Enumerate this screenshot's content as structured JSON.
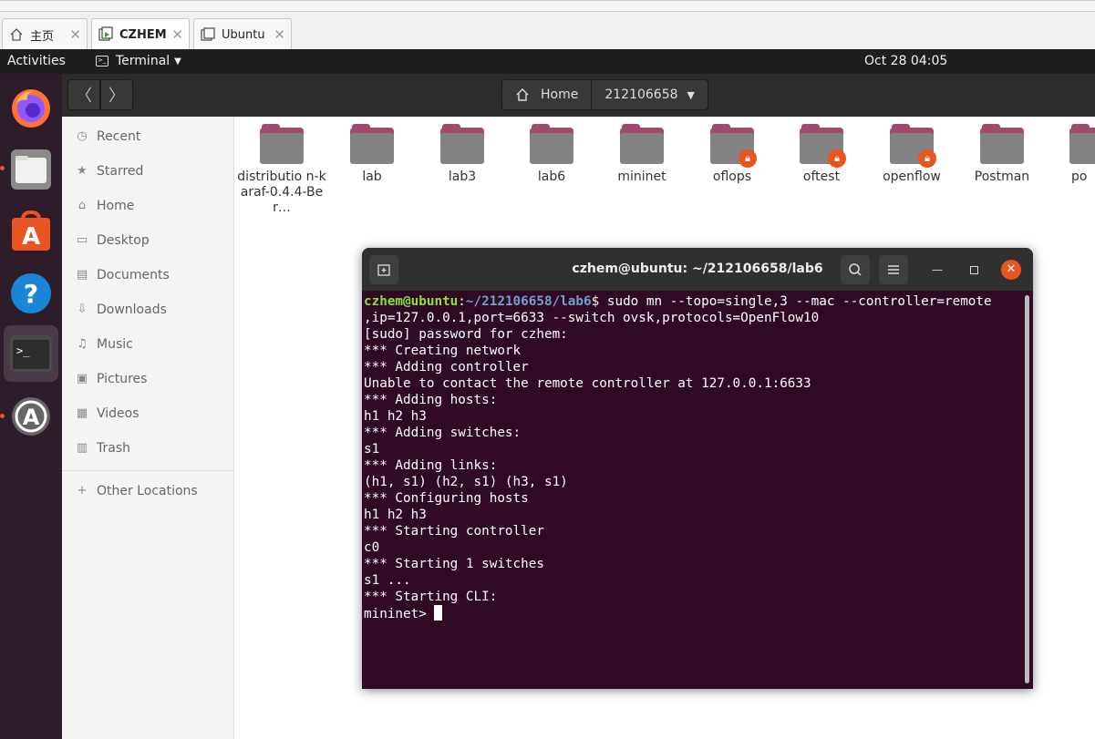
{
  "vm_tabs": [
    {
      "label": "主页",
      "icon": "home-icon"
    },
    {
      "label": "CZHEM",
      "icon": "vm-running-icon"
    },
    {
      "label": "Ubuntu",
      "icon": "vm-icon"
    }
  ],
  "topbar": {
    "activities": "Activities",
    "app_menu": "Terminal",
    "clock": "Oct 28  04:05"
  },
  "dock": [
    "firefox-icon",
    "files-icon",
    "software-center-icon",
    "help-icon",
    "terminal-icon",
    "software-updater-icon"
  ],
  "files_header": {
    "back_icon": "chevron-left-icon",
    "forward_icon": "chevron-right-icon",
    "path": [
      "Home",
      "212106658"
    ]
  },
  "sidebar": {
    "items": [
      {
        "label": "Recent",
        "icon": "clock-icon"
      },
      {
        "label": "Starred",
        "icon": "star-icon"
      },
      {
        "label": "Home",
        "icon": "home-icon"
      },
      {
        "label": "Desktop",
        "icon": "desktop-icon"
      },
      {
        "label": "Documents",
        "icon": "document-icon"
      },
      {
        "label": "Downloads",
        "icon": "download-icon"
      },
      {
        "label": "Music",
        "icon": "music-icon"
      },
      {
        "label": "Pictures",
        "icon": "picture-icon"
      },
      {
        "label": "Videos",
        "icon": "video-icon"
      },
      {
        "label": "Trash",
        "icon": "trash-icon"
      }
    ],
    "other": {
      "label": "Other Locations",
      "icon": "plus-icon"
    }
  },
  "folders": [
    {
      "name": "distributio n-karaf-0.4.4-Ber…",
      "locked": false
    },
    {
      "name": "lab",
      "locked": false
    },
    {
      "name": "lab3",
      "locked": false
    },
    {
      "name": "lab6",
      "locked": false
    },
    {
      "name": "mininet",
      "locked": false
    },
    {
      "name": "oflops",
      "locked": true
    },
    {
      "name": "oftest",
      "locked": true
    },
    {
      "name": "openflow",
      "locked": true
    },
    {
      "name": "Postman",
      "locked": false
    },
    {
      "name": "po",
      "locked": false
    }
  ],
  "terminal": {
    "title": "czhem@ubuntu: ~/212106658/lab6",
    "prompt_user": "czhem@ubuntu",
    "prompt_sep": ":",
    "prompt_path": "~/212106658/lab6",
    "prompt_end": "$ ",
    "command": "sudo mn --topo=single,3 --mac --controller=remote",
    "lines": [
      ",ip=127.0.0.1,port=6633 --switch ovsk,protocols=OpenFlow10",
      "[sudo] password for czhem:",
      "*** Creating network",
      "*** Adding controller",
      "Unable to contact the remote controller at 127.0.0.1:6633",
      "*** Adding hosts:",
      "h1 h2 h3",
      "*** Adding switches:",
      "s1",
      "*** Adding links:",
      "(h1, s1) (h2, s1) (h3, s1)",
      "*** Configuring hosts",
      "h1 h2 h3",
      "*** Starting controller",
      "c0",
      "*** Starting 1 switches",
      "s1 ...",
      "*** Starting CLI:"
    ],
    "final_prompt": "mininet> "
  }
}
